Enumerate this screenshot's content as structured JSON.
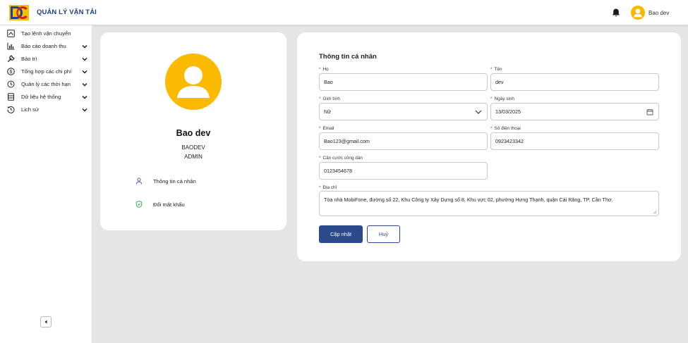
{
  "header": {
    "app_title": "QUẢN LÝ VẬN TẢI",
    "user_name": "Bao dev",
    "brand_color": "#1f3f86",
    "avatar_color": "#fbba00"
  },
  "sidebar": {
    "items": [
      {
        "label": "Tạo lệnh vận chuyển",
        "icon": "chart-up-icon",
        "has_chevron": false
      },
      {
        "label": "Báo cáo doanh thu",
        "icon": "bar-chart-icon",
        "has_chevron": true
      },
      {
        "label": "Bảo trì",
        "icon": "wrench-icon",
        "has_chevron": true
      },
      {
        "label": "Tổng hợp các chi phí",
        "icon": "dollar-icon",
        "has_chevron": true
      },
      {
        "label": "Quản lý các thời hạn",
        "icon": "clock-alert-icon",
        "has_chevron": true
      },
      {
        "label": "Dữ liệu hệ thống",
        "icon": "database-icon",
        "has_chevron": true
      },
      {
        "label": "Lịch sử",
        "icon": "history-icon",
        "has_chevron": true
      }
    ],
    "collapse_icon": "caret-left-icon"
  },
  "profile": {
    "name": "Bao dev",
    "username": "BAODEV",
    "role": "ADMIN",
    "links": [
      {
        "label": "Thông tin cá nhân",
        "icon": "user-icon"
      },
      {
        "label": "Đổi mật khẩu",
        "icon": "shield-icon"
      }
    ]
  },
  "form": {
    "title": "Thông tin cá nhân",
    "fields": {
      "last_name": {
        "label": "Họ",
        "value": "Bao"
      },
      "first_name": {
        "label": "Tên",
        "value": "dev"
      },
      "gender": {
        "label": "Giới tính",
        "value": "Nữ"
      },
      "birthday": {
        "label": "Ngày sinh",
        "value": "13/03/2025"
      },
      "email": {
        "label": "Email",
        "value": "Bao123@gmail.com"
      },
      "phone": {
        "label": "Số điện thoại",
        "value": "0923423342"
      },
      "id_card": {
        "label": "Căn cước công dân",
        "value": "0123454678"
      },
      "address": {
        "label": "Địa chỉ",
        "value": "Tòa nhà MobiFone, đường số 22, Khu Công ty Xây Dựng số 8, Khu vực 02, phường Hưng Thạnh, quận Cái Răng, TP. Cần Thơ."
      }
    },
    "required_mark": "*",
    "submit_label": "Cập nhật",
    "cancel_label": "Huỷ",
    "primary_color": "#2b4a8b"
  }
}
